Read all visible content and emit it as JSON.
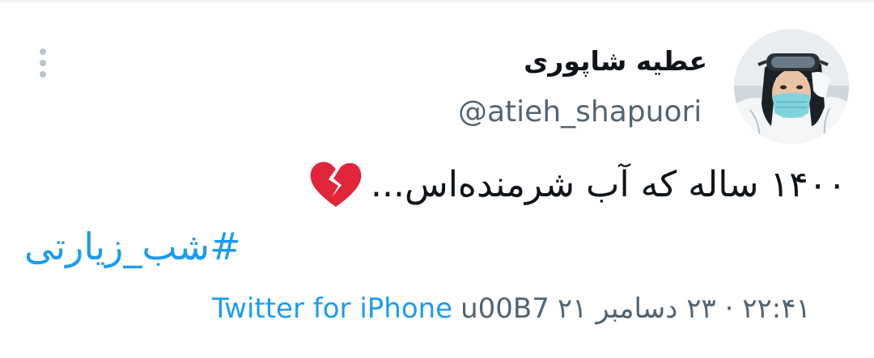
{
  "tweet": {
    "author": {
      "display_name": "عطیه شاپوری",
      "handle": "@atieh_shapuori",
      "avatar_alt": "profile photo of a health worker wearing goggles and a face mask"
    },
    "text": "۱۴۰۰ ساله که آب شرمنده‌اس...",
    "emoji": "broken-heart-icon",
    "hashtag": "#شب_زیارتی",
    "source": "Twitter for iPhone",
    "separator": "u00B7",
    "timestamp": "۲۲:۴۱ · ۲۳ دسامبر ۲۱"
  },
  "icons": {
    "more": "more-vertical-icon",
    "avatar": "avatar"
  },
  "colors": {
    "link": "#1d9bf0",
    "secondary_text": "#536471",
    "primary_text": "#0f1419",
    "heart": "#e1253a"
  }
}
